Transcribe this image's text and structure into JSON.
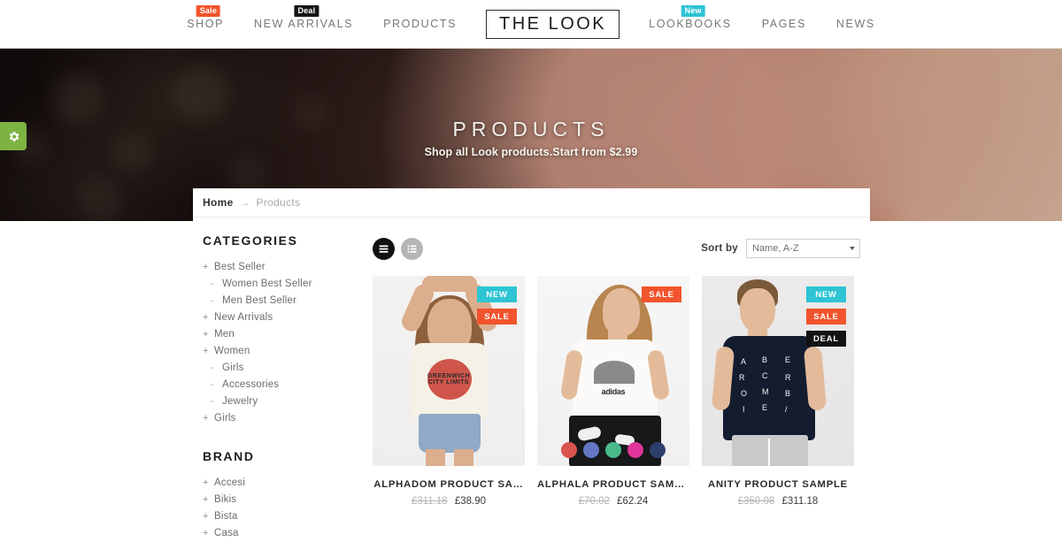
{
  "header": {
    "logo": "THE LOOK",
    "nav": [
      {
        "label": "SHOP",
        "badge": "Sale",
        "badge_color": "#f2542d"
      },
      {
        "label": "NEW ARRIVALS",
        "badge": "Deal",
        "badge_color": "#151515"
      },
      {
        "label": "PRODUCTS",
        "badge": "",
        "badge_color": ""
      },
      {
        "label": "LOOKBOOKS",
        "badge": "New",
        "badge_color": "#2ec4d4"
      },
      {
        "label": "PAGES",
        "badge": "",
        "badge_color": ""
      },
      {
        "label": "NEWS",
        "badge": "",
        "badge_color": ""
      }
    ]
  },
  "hero": {
    "title": "PRODUCTS",
    "subtitle": "Shop all Look products.Start from $2.99",
    "settings_tab_icon": "gear-icon",
    "settings_tab_color": "#7cb342"
  },
  "breadcrumb": {
    "home": "Home",
    "arrow": "→",
    "current": "Products"
  },
  "sidebar": {
    "categories_heading": "CATEGORIES",
    "categories": [
      {
        "mark": "+",
        "label": "Best Seller",
        "sub": false
      },
      {
        "mark": "-",
        "label": "Women Best Seller",
        "sub": true
      },
      {
        "mark": "-",
        "label": "Men Best Seller",
        "sub": true
      },
      {
        "mark": "+",
        "label": "New Arrivals",
        "sub": false
      },
      {
        "mark": "+",
        "label": "Men",
        "sub": false
      },
      {
        "mark": "+",
        "label": "Women",
        "sub": false
      },
      {
        "mark": "-",
        "label": "Girls",
        "sub": true
      },
      {
        "mark": "-",
        "label": "Accessories",
        "sub": true
      },
      {
        "mark": "-",
        "label": "Jewelry",
        "sub": true
      },
      {
        "mark": "+",
        "label": "Girls",
        "sub": false
      }
    ],
    "brand_heading": "BRAND",
    "brands": [
      {
        "mark": "+",
        "label": "Accesi"
      },
      {
        "mark": "+",
        "label": "Bikis"
      },
      {
        "mark": "+",
        "label": "Bista"
      },
      {
        "mark": "+",
        "label": "Casa"
      }
    ]
  },
  "toolbar": {
    "grid_view_icon": "grid-view-icon",
    "list_view_icon": "list-view-icon",
    "active_view": "grid",
    "sort_label": "Sort by",
    "sort_value": "Name, A-Z",
    "sort_options": [
      "Name, A-Z"
    ]
  },
  "products": [
    {
      "title": "ALPHADOM PRODUCT SA…",
      "price_old": "£311.18",
      "price_new": "£38.90",
      "badges": [
        {
          "label": "NEW",
          "color": "#2ec4d4"
        },
        {
          "label": "SALE",
          "color": "#f2542d"
        }
      ],
      "swatches": [],
      "tee_text": "GREENWICH"
    },
    {
      "title": "ALPHALA PRODUCT SAMP…",
      "price_old": "£70.02",
      "price_new": "£62.24",
      "badges": [
        {
          "label": "SALE",
          "color": "#f2542d"
        }
      ],
      "swatches": [
        "#d9534f",
        "#6477c4",
        "#49b98c",
        "#e0359a",
        "#2d3f6b"
      ],
      "tee_text": "adidas"
    },
    {
      "title": "ANITY PRODUCT SAMPLE",
      "price_old": "£350.08",
      "price_new": "£311.18",
      "badges": [
        {
          "label": "NEW",
          "color": "#2ec4d4"
        },
        {
          "label": "SALE",
          "color": "#f2542d"
        },
        {
          "label": "DEAL",
          "color": "#121212"
        }
      ],
      "swatches": [],
      "tee_letters": [
        "A",
        "B",
        "E",
        "R",
        "C",
        "R",
        "O",
        "M",
        "B",
        "I",
        "E",
        "/"
      ]
    }
  ]
}
